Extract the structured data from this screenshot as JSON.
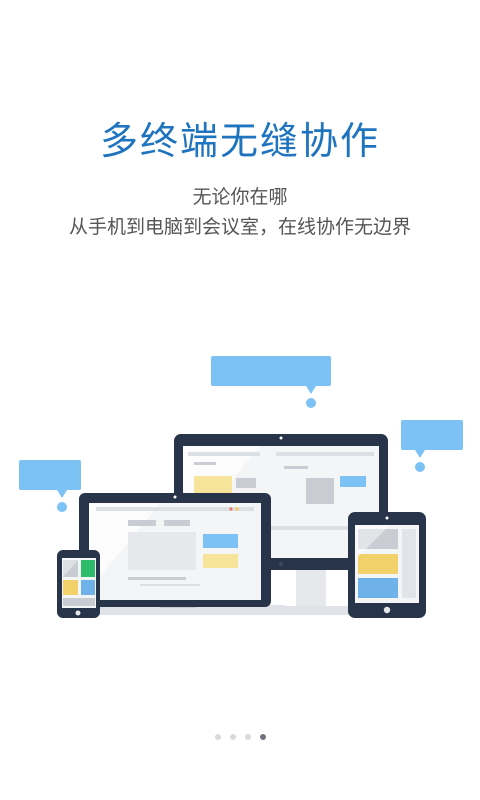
{
  "onboarding": {
    "title": "多终端无缝协作",
    "subtitle_line1": "无论你在哪",
    "subtitle_line2": "从手机到电脑到会议室，在线协作无边界"
  },
  "pager": {
    "total": 4,
    "active_index": 3
  },
  "colors": {
    "title": "#1f74bf",
    "bubble": "#7cc2f5",
    "device_frame": "#283449",
    "dot_inactive": "#d6d9de",
    "dot_active": "#6e7380"
  },
  "icons": [
    "speech-bubble-icon",
    "desktop-monitor-icon",
    "laptop-icon",
    "tablet-icon",
    "phone-icon"
  ]
}
